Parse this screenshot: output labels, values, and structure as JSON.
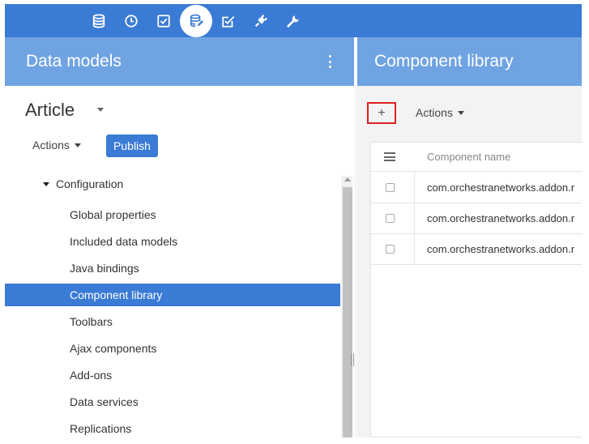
{
  "toolbar": {
    "icons": [
      "database-icon",
      "clock-icon",
      "checkbox-icon",
      "data-model-icon",
      "validation-icon",
      "plug-icon",
      "wrench-icon"
    ],
    "active_index": 3
  },
  "left_panel": {
    "title": "Data models",
    "model": "Article",
    "actions_label": "Actions",
    "publish_label": "Publish",
    "tree": {
      "root": "Configuration",
      "items": [
        "Global properties",
        "Included data models",
        "Java bindings",
        "Component library",
        "Toolbars",
        "Ajax components",
        "Add-ons",
        "Data services",
        "Replications"
      ],
      "selected": "Component library"
    }
  },
  "right_panel": {
    "title": "Component library",
    "add_label": "+",
    "actions_label": "Actions",
    "table": {
      "column": "Component name",
      "rows": [
        "com.orchestranetworks.addon.r",
        "com.orchestranetworks.addon.r",
        "com.orchestranetworks.addon.r"
      ]
    }
  },
  "colors": {
    "toolbar": "#3a7bd5",
    "header": "#6fa3e2",
    "selected": "#3a7bd5",
    "add_highlight": "#e02020"
  }
}
